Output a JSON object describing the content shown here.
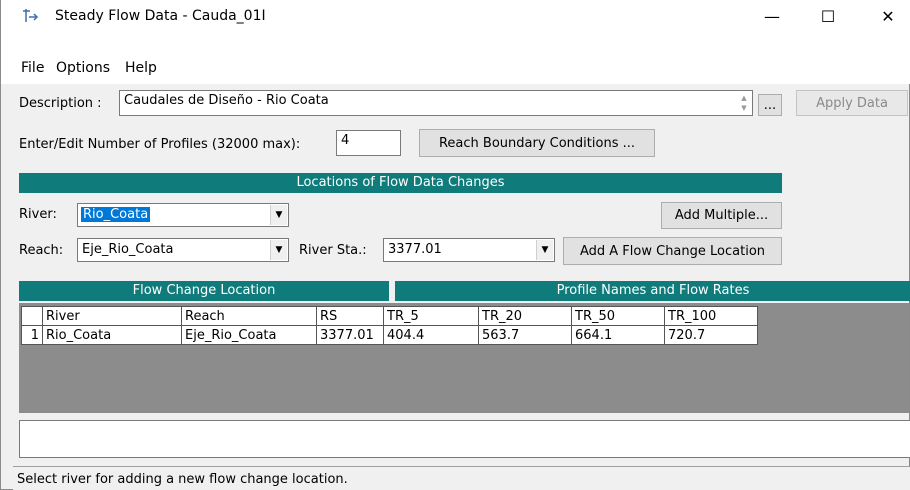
{
  "window": {
    "title": "Steady Flow Data - Cauda_01I",
    "minimize": "—",
    "maximize": "☐",
    "close": "✕"
  },
  "menu": [
    "File",
    "Options",
    "Help"
  ],
  "description": {
    "label": "Description :",
    "value": "Caudales de Diseño - Rio Coata",
    "ellipsis_button": "...",
    "apply_button": "Apply Data"
  },
  "profiles": {
    "label": "Enter/Edit Number of Profiles (32000 max):",
    "value": "4",
    "boundary_button": "Reach Boundary Conditions ..."
  },
  "locations": {
    "header": "Locations of Flow Data Changes",
    "river_label": "River:",
    "river_value": "Rio_Coata",
    "add_multiple_button": "Add Multiple...",
    "reach_label": "Reach:",
    "reach_value": "Eje_Rio_Coata",
    "station_label": "River Sta.:",
    "station_value": "3377.01",
    "add_location_button": "Add A Flow Change Location"
  },
  "table": {
    "left_header": "Flow Change Location",
    "right_header": "Profile Names and Flow Rates",
    "columns": [
      "River",
      "Reach",
      "RS",
      "TR_5",
      "TR_20",
      "TR_50",
      "TR_100"
    ],
    "rows": [
      {
        "num": "1",
        "cells": [
          "Rio_Coata",
          "Eje_Rio_Coata",
          "3377.01",
          "404.4",
          "563.7",
          "664.1",
          "720.7"
        ]
      }
    ]
  },
  "status": "Select river for adding a new flow change location."
}
